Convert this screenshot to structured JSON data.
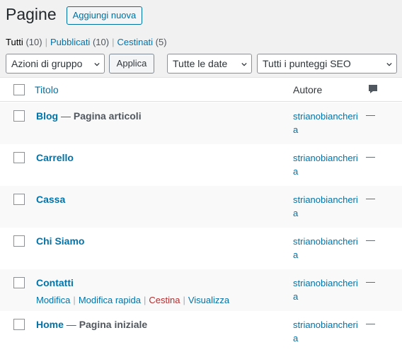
{
  "header": {
    "title": "Pagine",
    "add_new_label": "Aggiungi nuova"
  },
  "filters": {
    "views": [
      {
        "label": "Tutti",
        "count": "(10)",
        "current": true
      },
      {
        "label": "Pubblicati",
        "count": "(10)",
        "current": false
      },
      {
        "label": "Cestinati",
        "count": "(5)",
        "current": false
      }
    ]
  },
  "tablenav": {
    "bulk_actions": "Azioni di gruppo",
    "apply_label": "Applica",
    "date_filter": "Tutte le date",
    "seo_filter": "Tutti i punteggi SEO"
  },
  "table": {
    "columns": {
      "title": "Titolo",
      "author": "Autore",
      "comments_icon": "comment-icon"
    },
    "rows": [
      {
        "title": "Blog",
        "state": "Pagina articoli",
        "author": "strianobiancheria",
        "comments": "—"
      },
      {
        "title": "Carrello",
        "state": "",
        "author": "strianobiancheria",
        "comments": "—"
      },
      {
        "title": "Cassa",
        "state": "",
        "author": "strianobiancheria",
        "comments": "—"
      },
      {
        "title": "Chi Siamo",
        "state": "",
        "author": "strianobiancheria",
        "comments": "—"
      },
      {
        "title": "Contatti",
        "state": "",
        "author": "strianobiancheria",
        "comments": "—",
        "actions": [
          "Modifica",
          "Modifica rapida",
          "Cestina",
          "Visualizza"
        ]
      },
      {
        "title": "Home",
        "state": "Pagina iniziale",
        "author": "strianobiancheria",
        "comments": "—"
      }
    ]
  },
  "colors": {
    "link": "#0073aa",
    "trash": "#b32d2e",
    "background": "#f1f1f1"
  }
}
